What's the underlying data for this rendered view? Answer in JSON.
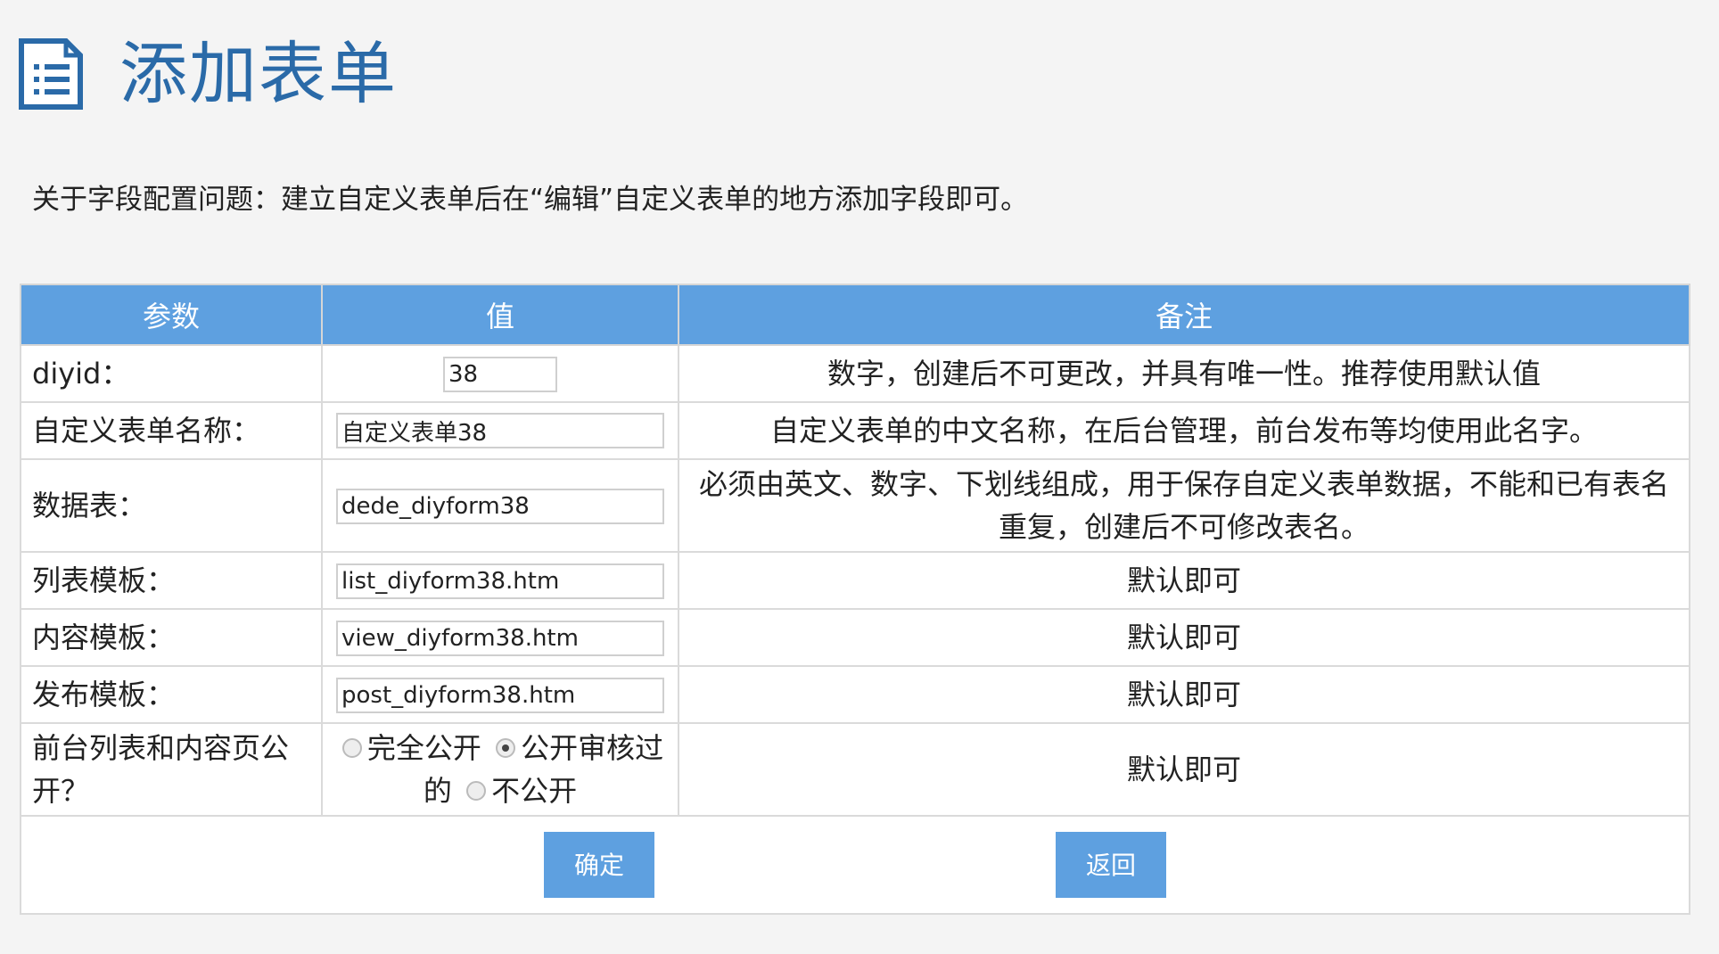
{
  "page": {
    "title": "添加表单",
    "notice": "关于字段配置问题：建立自定义表单后在“编辑”自定义表单的地方添加字段即可。"
  },
  "table": {
    "headers": [
      "参数",
      "值",
      "备注"
    ],
    "rows": [
      {
        "label": "diyid：",
        "value": "38",
        "note": "数字，创建后不可更改，并具有唯一性。推荐使用默认值"
      },
      {
        "label": "自定义表单名称：",
        "value": "自定义表单38",
        "note": "自定义表单的中文名称，在后台管理，前台发布等均使用此名字。"
      },
      {
        "label": "数据表：",
        "value": "dede_diyform38",
        "note": "必须由英文、数字、下划线组成，用于保存自定义表单数据，不能和已有表名重复，创建后不可修改表名。"
      },
      {
        "label": "列表模板：",
        "value": "list_diyform38.htm",
        "note": "默认即可"
      },
      {
        "label": "内容模板：",
        "value": "view_diyform38.htm",
        "note": "默认即可"
      },
      {
        "label": "发布模板：",
        "value": "post_diyform38.htm",
        "note": "默认即可"
      },
      {
        "label": "前台列表和内容页公开？",
        "note": "默认即可"
      }
    ],
    "public_options": {
      "option1": "完全公开",
      "option2": "公开审核过的",
      "option3": "不公开",
      "selected": "公开审核过的"
    }
  },
  "buttons": {
    "confirm": "确定",
    "back": "返回"
  },
  "colors": {
    "accent": "#5ea0e0",
    "title": "#2a6aa8"
  },
  "icons": {
    "header_icon": "document-list-icon"
  }
}
